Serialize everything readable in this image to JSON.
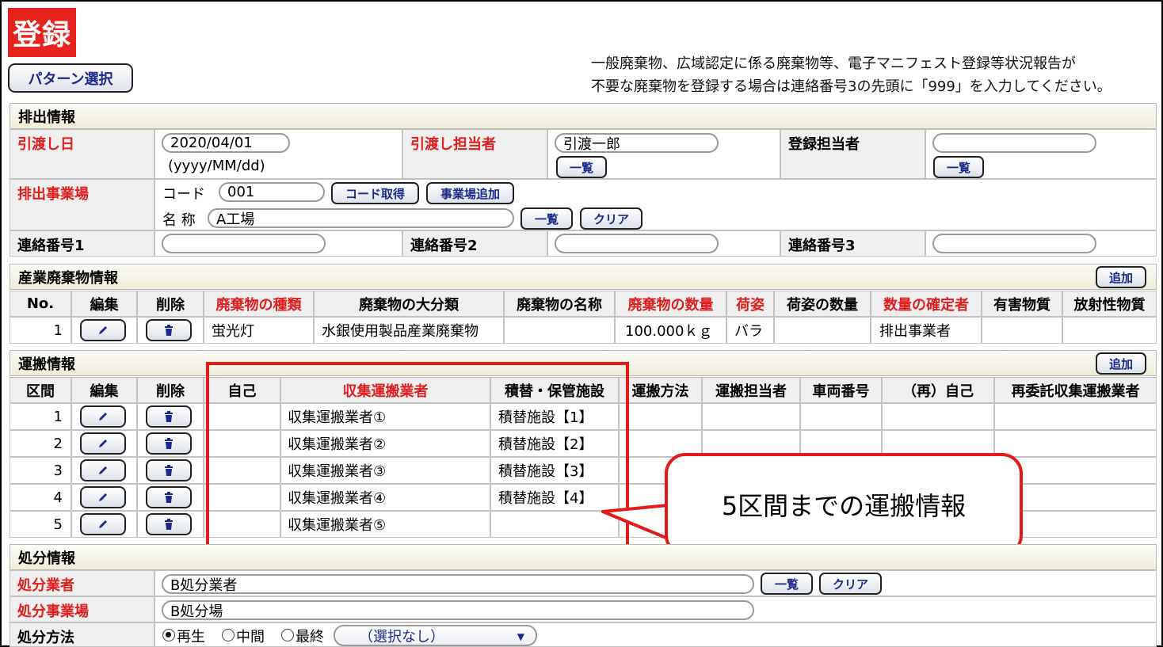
{
  "header": {
    "badge": "登録",
    "pattern_button": "パターン選択",
    "notice_line1": "一般廃棄物、広域認定に係る廃棄物等、電子マニフェスト登録等状況報告が",
    "notice_line2": "不要な廃棄物を登録する場合は連絡番号3の先頭に「999」を入力してください。"
  },
  "discharge": {
    "section_title": "排出情報",
    "handover_date_label": "引渡し日",
    "handover_date_value": "2020/04/01",
    "date_format": "(yyyy/MM/dd)",
    "handover_person_label": "引渡し担当者",
    "handover_person_value": "引渡一郎",
    "list_button": "一覧",
    "registrant_label": "登録担当者",
    "registrant_value": "",
    "site_label": "排出事業場",
    "code_label": "コード",
    "code_value": "001",
    "get_code_button": "コード取得",
    "add_site_button": "事業場追加",
    "name_label": "名 称",
    "name_value": "A工場",
    "clear_button": "クリア",
    "contact1_label": "連絡番号1",
    "contact2_label": "連絡番号2",
    "contact3_label": "連絡番号3",
    "contact1_value": "",
    "contact2_value": "",
    "contact3_value": ""
  },
  "waste": {
    "section_title": "産業廃棄物情報",
    "add_button": "追加",
    "columns": [
      "No.",
      "編集",
      "削除",
      "廃棄物の種類",
      "廃棄物の大分類",
      "廃棄物の名称",
      "廃棄物の数量",
      "荷姿",
      "荷姿の数量",
      "数量の確定者",
      "有害物質",
      "放射性物質"
    ],
    "rows": [
      {
        "no": "1",
        "type": "蛍光灯",
        "category": "水銀使用製品産業廃棄物",
        "name": "",
        "quantity": "100.000ｋｇ",
        "packaging": "バラ",
        "pack_qty": "",
        "confirmer": "排出事業者",
        "hazardous": "",
        "radioactive": ""
      }
    ]
  },
  "transport": {
    "section_title": "運搬情報",
    "add_button": "追加",
    "columns": [
      "区間",
      "編集",
      "削除",
      "自己",
      "収集運搬業者",
      "積替・保管施設",
      "運搬方法",
      "運搬担当者",
      "車両番号",
      "（再）自己",
      "再委託収集運搬業者"
    ],
    "rows": [
      {
        "no": "1",
        "carrier": "収集運搬業者①",
        "facility": "積替施設【1】"
      },
      {
        "no": "2",
        "carrier": "収集運搬業者②",
        "facility": "積替施設【2】"
      },
      {
        "no": "3",
        "carrier": "収集運搬業者③",
        "facility": "積替施設【3】"
      },
      {
        "no": "4",
        "carrier": "収集運搬業者④",
        "facility": "積替施設【4】"
      },
      {
        "no": "5",
        "carrier": "収集運搬業者⑤",
        "facility": ""
      }
    ],
    "callout": "5区間までの運搬情報"
  },
  "disposal": {
    "section_title": "処分情報",
    "operator_label": "処分業者",
    "operator_value": "B処分業者",
    "list_button": "一覧",
    "clear_button": "クリア",
    "site_label": "処分事業場",
    "site_value": "B処分場",
    "method_label": "処分方法",
    "method_options": [
      "再生",
      "中間",
      "最終"
    ],
    "method_selected": "再生",
    "select_value": "（選択なし）"
  },
  "colors": {
    "required_label": "#e11d1d",
    "callout_border": "#e31b1b",
    "button_text": "#1a2a8a"
  }
}
